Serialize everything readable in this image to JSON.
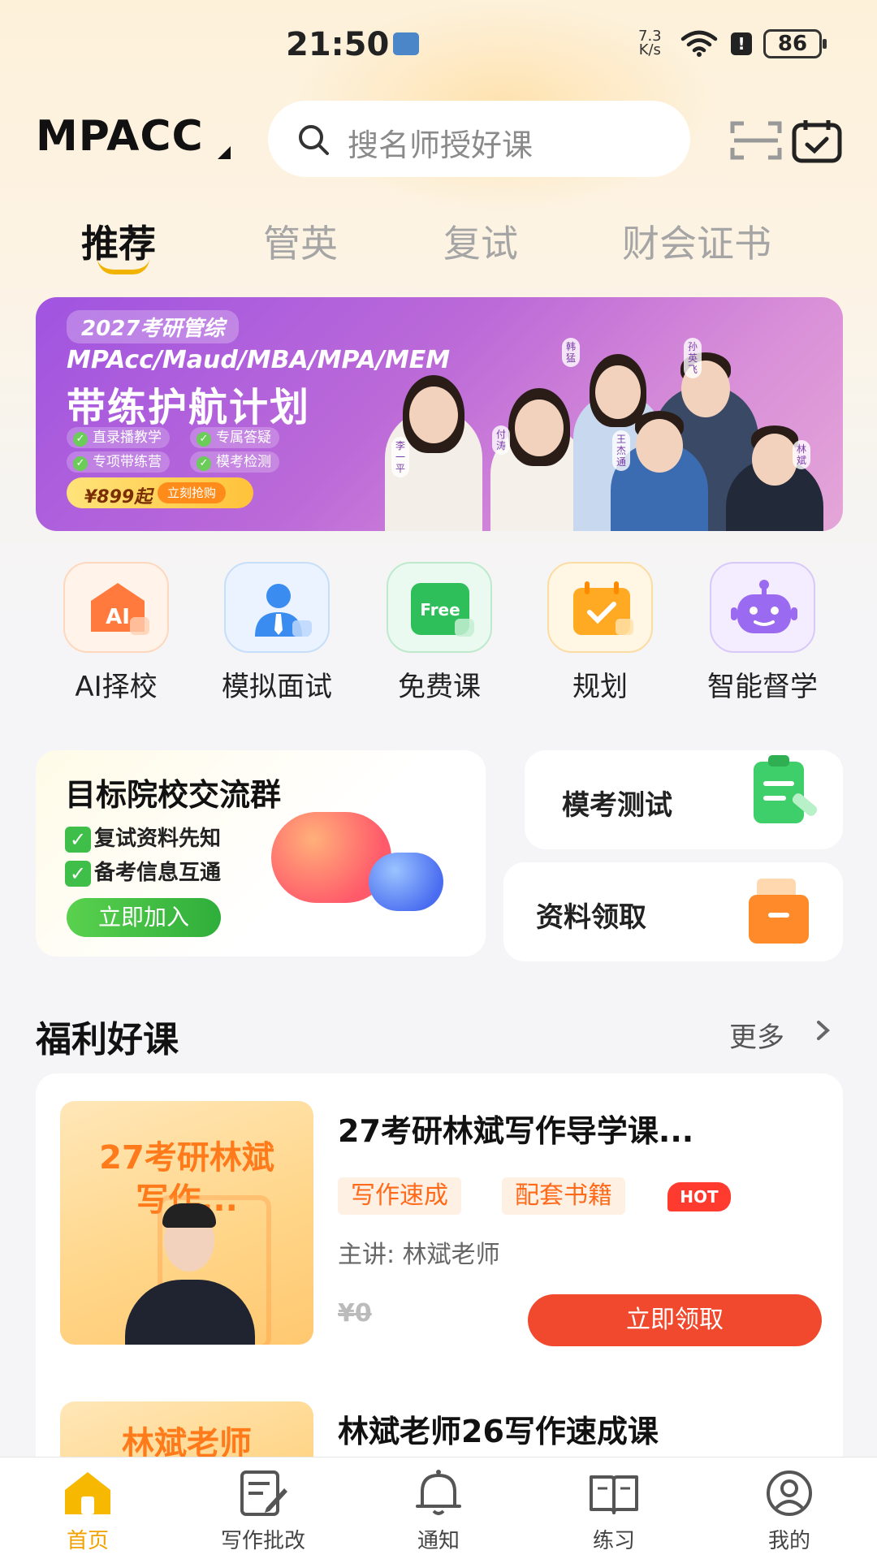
{
  "status_bar": {
    "time": "21:50",
    "net_speed_value": "7.3",
    "net_speed_unit": "K/s",
    "battery": "86"
  },
  "header": {
    "logo": "MPACC",
    "search_placeholder": "搜名师授好课",
    "icons": [
      "scan-icon",
      "calendar-check-icon"
    ]
  },
  "tabs": [
    {
      "label": "推荐",
      "active": true
    },
    {
      "label": "管英",
      "active": false
    },
    {
      "label": "复试",
      "active": false
    },
    {
      "label": "财会证书",
      "active": false
    }
  ],
  "banner": {
    "tag": "2027考研管综",
    "line1": "MPAcc/Maud/MBA/MPA/MEM",
    "line2": "带练护航计划",
    "chips": [
      "直录播教学",
      "专属答疑",
      "专项带练营",
      "模考检测"
    ],
    "price": "¥899起",
    "cta": "立刻抢购",
    "teachers": [
      "李一平",
      "付涛",
      "韩猛",
      "王杰通",
      "孙英飞",
      "林斌"
    ]
  },
  "quick_actions": [
    {
      "label": "AI择校",
      "icon": "ai-school-icon",
      "color": "#ff7a3c"
    },
    {
      "label": "模拟面试",
      "icon": "interview-person-icon",
      "color": "#3a8cf0"
    },
    {
      "label": "免费课",
      "icon": "free-course-icon",
      "color": "#2fbf5a"
    },
    {
      "label": "规划",
      "icon": "plan-calendar-icon",
      "color": "#ffaa22"
    },
    {
      "label": "智能督学",
      "icon": "robot-icon",
      "color": "#9a6af0"
    }
  ],
  "group_card": {
    "title": "目标院校交流群",
    "lines": [
      "复试资料先知",
      "备考信息互通"
    ],
    "button": "立即加入"
  },
  "side_cards": [
    {
      "label": "模考测试",
      "icon": "exam-clipboard-icon"
    },
    {
      "label": "资料领取",
      "icon": "materials-box-icon"
    }
  ],
  "section": {
    "title": "福利好课",
    "more": "更多"
  },
  "courses": [
    {
      "thumb_text": "27考研林斌写作...",
      "title": "27考研林斌写作导学课...",
      "tags": [
        "写作速成",
        "配套书籍"
      ],
      "hot": "HOT",
      "teacher_label": "主讲:",
      "teacher": "林斌老师",
      "price": "¥0",
      "cta": "立即领取"
    },
    {
      "thumb_text": "林斌老师",
      "title": "林斌老师26写作速成课"
    }
  ],
  "bottom_nav": [
    {
      "label": "首页",
      "icon": "home-icon",
      "active": true
    },
    {
      "label": "写作批改",
      "icon": "edit-note-icon",
      "active": false
    },
    {
      "label": "通知",
      "icon": "bell-icon",
      "active": false
    },
    {
      "label": "练习",
      "icon": "open-book-icon",
      "active": false
    },
    {
      "label": "我的",
      "icon": "user-profile-icon",
      "active": false
    }
  ]
}
